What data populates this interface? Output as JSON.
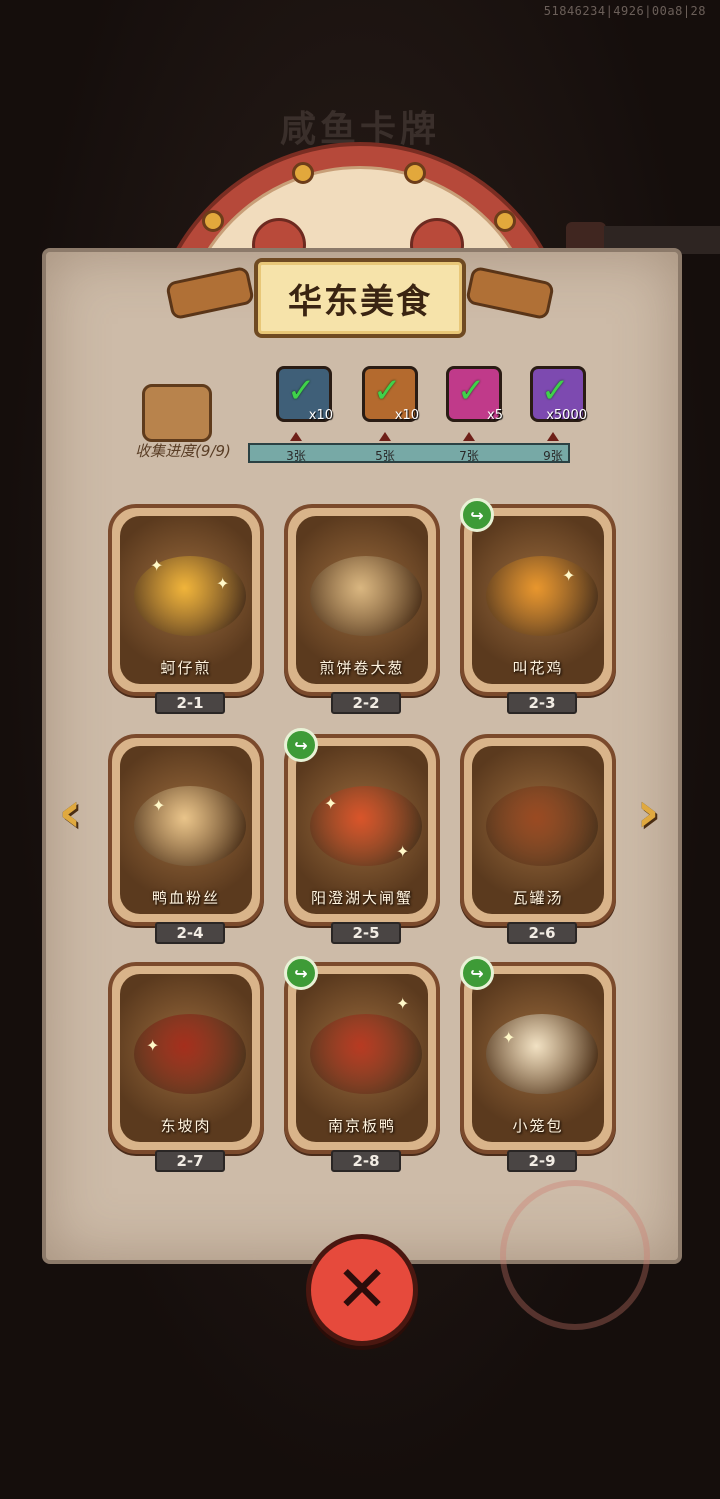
{
  "debug_id": "51846234|4926|00a8|28",
  "background_title": "咸鱼卡牌",
  "banner": {
    "title": "华东美食"
  },
  "collection": {
    "label": "收集进度(9/9)",
    "progress": 1.0,
    "milestones": [
      "3张",
      "5张",
      "7张",
      "9张"
    ]
  },
  "rewards": [
    {
      "icon": "treasure-chest-icon",
      "count": "x10",
      "color": "#3f5f78"
    },
    {
      "icon": "key-icon",
      "count": "x10",
      "color": "#b46a2e"
    },
    {
      "icon": "magic-orb-icon",
      "count": "x5",
      "color": "#c03a8a"
    },
    {
      "icon": "gem-icon",
      "count": "x5000",
      "color": "#7d4ab0"
    }
  ],
  "cards": [
    {
      "name": "蚵仔煎",
      "number": "2-1",
      "shared": false,
      "dish_color": "#f0b43a"
    },
    {
      "name": "煎饼卷大葱",
      "number": "2-2",
      "shared": false,
      "dish_color": "#d9b680"
    },
    {
      "name": "叫花鸡",
      "number": "2-3",
      "shared": true,
      "dish_color": "#e8962d"
    },
    {
      "name": "鸭血粉丝",
      "number": "2-4",
      "shared": false,
      "dish_color": "#e9c48a"
    },
    {
      "name": "阳澄湖大闸蟹",
      "number": "2-5",
      "shared": true,
      "dish_color": "#d9542a"
    },
    {
      "name": "瓦罐汤",
      "number": "2-6",
      "shared": false,
      "dish_color": "#9a4a22"
    },
    {
      "name": "东坡肉",
      "number": "2-7",
      "shared": false,
      "dish_color": "#a52e1c"
    },
    {
      "name": "南京板鸭",
      "number": "2-8",
      "shared": true,
      "dish_color": "#b83a22"
    },
    {
      "name": "小笼包",
      "number": "2-9",
      "shared": true,
      "dish_color": "#f1e1c3"
    }
  ],
  "nav": {
    "prev": "‹",
    "next": "›"
  },
  "close_label": "✕",
  "share_glyph": "↪",
  "accent": {
    "banner": "#f6e3aa",
    "close": "#e64a3c",
    "share": "#3e9b37"
  }
}
